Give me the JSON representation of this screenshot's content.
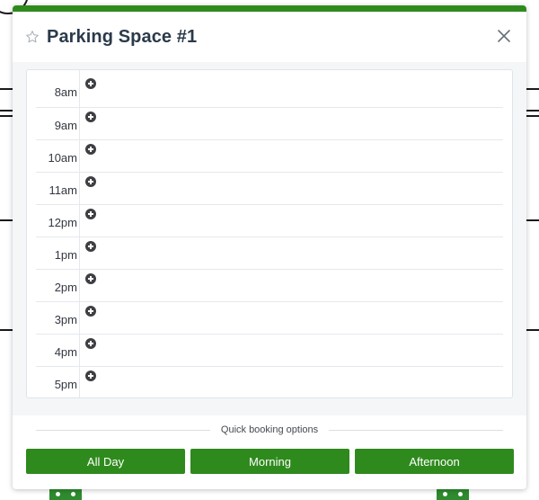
{
  "modal": {
    "title": "Parking Space #1",
    "favorite_icon": "star-outline-icon",
    "close_icon": "close-icon",
    "accent_color": "#2f8a1d"
  },
  "schedule": {
    "add_icon": "plus-circle-icon",
    "slots": [
      {
        "time": "8am"
      },
      {
        "time": "9am"
      },
      {
        "time": "10am"
      },
      {
        "time": "11am"
      },
      {
        "time": "12pm"
      },
      {
        "time": "1pm"
      },
      {
        "time": "2pm"
      },
      {
        "time": "3pm"
      },
      {
        "time": "4pm"
      },
      {
        "time": "5pm"
      }
    ]
  },
  "quick_booking": {
    "label": "Quick booking options",
    "buttons": [
      {
        "label": "All Day"
      },
      {
        "label": "Morning"
      },
      {
        "label": "Afternoon"
      }
    ]
  }
}
